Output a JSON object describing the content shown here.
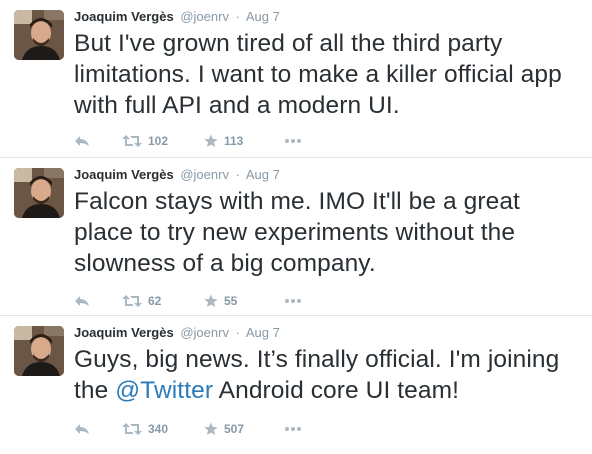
{
  "colors": {
    "link": "#2b7bb9",
    "meta": "#8899a6",
    "text": "#292f33",
    "divider": "#e1e8ed"
  },
  "tweets": [
    {
      "fullname": "Joaquim Vergès",
      "handle": "@joenrv",
      "separator": "·",
      "time": "Aug 7",
      "text_before": "But I've grown tired of all the third party limitations. I want to make a killer official app with full API and a modern UI.",
      "mention": "",
      "text_after": "",
      "retweets": "102",
      "favorites": "113",
      "icons": [
        "reply-icon",
        "retweet-icon",
        "favorite-star-icon",
        "more-dots-icon"
      ]
    },
    {
      "fullname": "Joaquim Vergès",
      "handle": "@joenrv",
      "separator": "·",
      "time": "Aug 7",
      "text_before": "Falcon stays with me. IMO It'll be a great place to try new experiments without the slowness of a big company.",
      "mention": "",
      "text_after": "",
      "retweets": "62",
      "favorites": "55",
      "icons": [
        "reply-icon",
        "retweet-icon",
        "favorite-star-icon",
        "more-dots-icon"
      ]
    },
    {
      "fullname": "Joaquim Vergès",
      "handle": "@joenrv",
      "separator": "·",
      "time": "Aug 7",
      "text_before": "Guys, big news. It’s finally official. I'm joining the ",
      "mention": "@Twitter",
      "text_after": " Android core UI team!",
      "retweets": "340",
      "favorites": "507",
      "icons": [
        "reply-icon",
        "retweet-icon",
        "favorite-star-icon",
        "more-dots-icon"
      ]
    }
  ]
}
